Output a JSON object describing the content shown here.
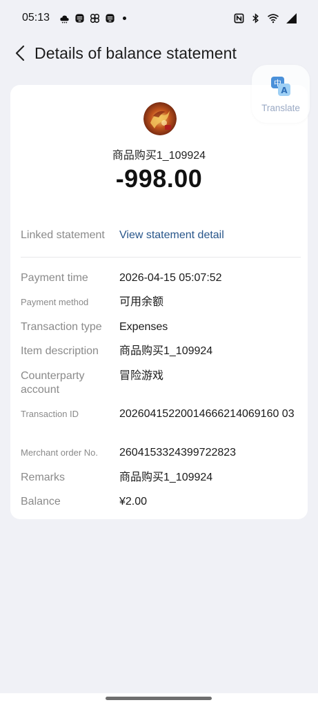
{
  "status_bar": {
    "time": "05:13",
    "left_icons": [
      "cloud-icon",
      "app-icon",
      "pinwheel-icon",
      "app-icon",
      "dot-icon"
    ],
    "right_icons": [
      "nfc-icon",
      "bluetooth-icon",
      "wifi-icon",
      "signal-icon"
    ]
  },
  "header": {
    "title": "Details of balance statement"
  },
  "translate": {
    "label": "Translate"
  },
  "summary": {
    "merchant_name": "商品购买1_109924",
    "amount": "-998.00"
  },
  "linked": {
    "label": "Linked statement",
    "value": "View statement detail"
  },
  "details": [
    {
      "label": "Payment time",
      "value": "2026-04-15 05:07:52",
      "small": false
    },
    {
      "label": "Payment method",
      "value": "可用余额",
      "small": true
    },
    {
      "label": "Transaction type",
      "value": "Expenses",
      "small": false
    },
    {
      "label": "Item description",
      "value": "商品购买1_109924",
      "small": false
    },
    {
      "label": "Counterparty account",
      "value": "冒险游戏",
      "small": false
    },
    {
      "label": "Transaction ID",
      "value": "20260415220014666214069160 03",
      "small": true
    },
    {
      "label": "Merchant order No.",
      "value": "2604153324399722823",
      "small": true
    },
    {
      "label": "Remarks",
      "value": "商品购买1_109924",
      "small": false
    },
    {
      "label": "Balance",
      "value": "¥2.00",
      "small": false
    }
  ],
  "colors": {
    "background": "#f0f1f6",
    "card": "#ffffff",
    "link": "#27558a",
    "label": "#8a8a8a",
    "translate_text": "#9aa9c4"
  }
}
